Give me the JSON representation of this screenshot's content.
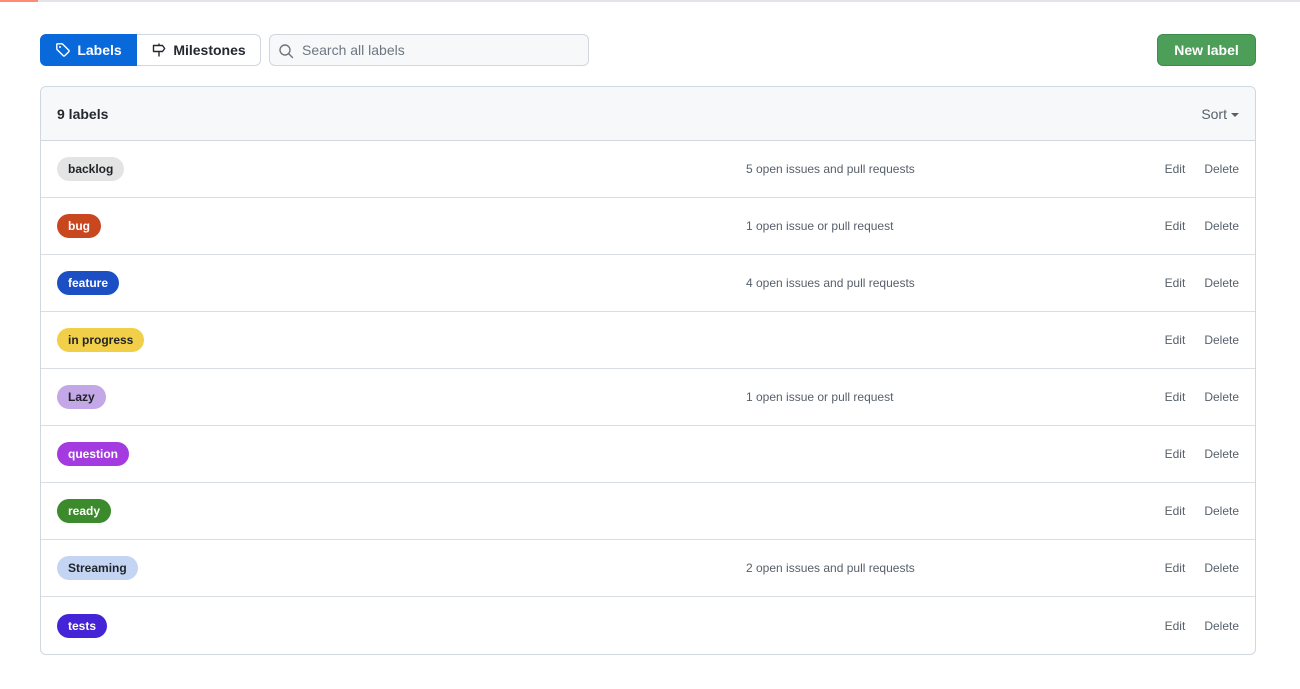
{
  "nav": {
    "labels_tab": "Labels",
    "milestones_tab": "Milestones",
    "search_placeholder": "Search all labels",
    "new_label_button": "New label"
  },
  "list": {
    "count_label": "9 labels",
    "sort_label": "Sort",
    "edit_label": "Edit",
    "delete_label": "Delete"
  },
  "labels": [
    {
      "name": "backlog",
      "bg": "#e4e4e4",
      "fg": "#1f2328",
      "issues": "5 open issues and pull requests"
    },
    {
      "name": "bug",
      "bg": "#c9471f",
      "fg": "#ffffff",
      "issues": "1 open issue or pull request"
    },
    {
      "name": "feature",
      "bg": "#1d4fc4",
      "fg": "#ffffff",
      "issues": "4 open issues and pull requests"
    },
    {
      "name": "in progress",
      "bg": "#f1cf48",
      "fg": "#1f2328",
      "issues": ""
    },
    {
      "name": "Lazy",
      "bg": "#c3a7e6",
      "fg": "#1f2328",
      "issues": "1 open issue or pull request"
    },
    {
      "name": "question",
      "bg": "#a33be0",
      "fg": "#ffffff",
      "issues": ""
    },
    {
      "name": "ready",
      "bg": "#3b8a2c",
      "fg": "#ffffff",
      "issues": ""
    },
    {
      "name": "Streaming",
      "bg": "#c3d5f2",
      "fg": "#1f2328",
      "issues": "2 open issues and pull requests"
    },
    {
      "name": "tests",
      "bg": "#4523d6",
      "fg": "#ffffff",
      "issues": ""
    }
  ],
  "icons": {
    "labels_tab": "tag-icon",
    "milestones_tab": "milestone-icon",
    "search": "search-icon",
    "sort": "caret-down-icon"
  }
}
